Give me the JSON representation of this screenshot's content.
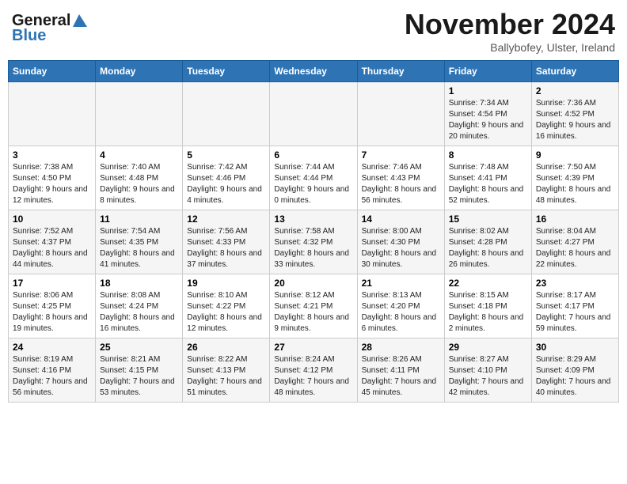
{
  "header": {
    "logo_line1": "General",
    "logo_line2": "Blue",
    "month": "November 2024",
    "location": "Ballybofey, Ulster, Ireland"
  },
  "calendar": {
    "days_of_week": [
      "Sunday",
      "Monday",
      "Tuesday",
      "Wednesday",
      "Thursday",
      "Friday",
      "Saturday"
    ],
    "weeks": [
      [
        {
          "day": "",
          "info": ""
        },
        {
          "day": "",
          "info": ""
        },
        {
          "day": "",
          "info": ""
        },
        {
          "day": "",
          "info": ""
        },
        {
          "day": "",
          "info": ""
        },
        {
          "day": "1",
          "info": "Sunrise: 7:34 AM\nSunset: 4:54 PM\nDaylight: 9 hours and 20 minutes."
        },
        {
          "day": "2",
          "info": "Sunrise: 7:36 AM\nSunset: 4:52 PM\nDaylight: 9 hours and 16 minutes."
        }
      ],
      [
        {
          "day": "3",
          "info": "Sunrise: 7:38 AM\nSunset: 4:50 PM\nDaylight: 9 hours and 12 minutes."
        },
        {
          "day": "4",
          "info": "Sunrise: 7:40 AM\nSunset: 4:48 PM\nDaylight: 9 hours and 8 minutes."
        },
        {
          "day": "5",
          "info": "Sunrise: 7:42 AM\nSunset: 4:46 PM\nDaylight: 9 hours and 4 minutes."
        },
        {
          "day": "6",
          "info": "Sunrise: 7:44 AM\nSunset: 4:44 PM\nDaylight: 9 hours and 0 minutes."
        },
        {
          "day": "7",
          "info": "Sunrise: 7:46 AM\nSunset: 4:43 PM\nDaylight: 8 hours and 56 minutes."
        },
        {
          "day": "8",
          "info": "Sunrise: 7:48 AM\nSunset: 4:41 PM\nDaylight: 8 hours and 52 minutes."
        },
        {
          "day": "9",
          "info": "Sunrise: 7:50 AM\nSunset: 4:39 PM\nDaylight: 8 hours and 48 minutes."
        }
      ],
      [
        {
          "day": "10",
          "info": "Sunrise: 7:52 AM\nSunset: 4:37 PM\nDaylight: 8 hours and 44 minutes."
        },
        {
          "day": "11",
          "info": "Sunrise: 7:54 AM\nSunset: 4:35 PM\nDaylight: 8 hours and 41 minutes."
        },
        {
          "day": "12",
          "info": "Sunrise: 7:56 AM\nSunset: 4:33 PM\nDaylight: 8 hours and 37 minutes."
        },
        {
          "day": "13",
          "info": "Sunrise: 7:58 AM\nSunset: 4:32 PM\nDaylight: 8 hours and 33 minutes."
        },
        {
          "day": "14",
          "info": "Sunrise: 8:00 AM\nSunset: 4:30 PM\nDaylight: 8 hours and 30 minutes."
        },
        {
          "day": "15",
          "info": "Sunrise: 8:02 AM\nSunset: 4:28 PM\nDaylight: 8 hours and 26 minutes."
        },
        {
          "day": "16",
          "info": "Sunrise: 8:04 AM\nSunset: 4:27 PM\nDaylight: 8 hours and 22 minutes."
        }
      ],
      [
        {
          "day": "17",
          "info": "Sunrise: 8:06 AM\nSunset: 4:25 PM\nDaylight: 8 hours and 19 minutes."
        },
        {
          "day": "18",
          "info": "Sunrise: 8:08 AM\nSunset: 4:24 PM\nDaylight: 8 hours and 16 minutes."
        },
        {
          "day": "19",
          "info": "Sunrise: 8:10 AM\nSunset: 4:22 PM\nDaylight: 8 hours and 12 minutes."
        },
        {
          "day": "20",
          "info": "Sunrise: 8:12 AM\nSunset: 4:21 PM\nDaylight: 8 hours and 9 minutes."
        },
        {
          "day": "21",
          "info": "Sunrise: 8:13 AM\nSunset: 4:20 PM\nDaylight: 8 hours and 6 minutes."
        },
        {
          "day": "22",
          "info": "Sunrise: 8:15 AM\nSunset: 4:18 PM\nDaylight: 8 hours and 2 minutes."
        },
        {
          "day": "23",
          "info": "Sunrise: 8:17 AM\nSunset: 4:17 PM\nDaylight: 7 hours and 59 minutes."
        }
      ],
      [
        {
          "day": "24",
          "info": "Sunrise: 8:19 AM\nSunset: 4:16 PM\nDaylight: 7 hours and 56 minutes."
        },
        {
          "day": "25",
          "info": "Sunrise: 8:21 AM\nSunset: 4:15 PM\nDaylight: 7 hours and 53 minutes."
        },
        {
          "day": "26",
          "info": "Sunrise: 8:22 AM\nSunset: 4:13 PM\nDaylight: 7 hours and 51 minutes."
        },
        {
          "day": "27",
          "info": "Sunrise: 8:24 AM\nSunset: 4:12 PM\nDaylight: 7 hours and 48 minutes."
        },
        {
          "day": "28",
          "info": "Sunrise: 8:26 AM\nSunset: 4:11 PM\nDaylight: 7 hours and 45 minutes."
        },
        {
          "day": "29",
          "info": "Sunrise: 8:27 AM\nSunset: 4:10 PM\nDaylight: 7 hours and 42 minutes."
        },
        {
          "day": "30",
          "info": "Sunrise: 8:29 AM\nSunset: 4:09 PM\nDaylight: 7 hours and 40 minutes."
        }
      ]
    ]
  }
}
